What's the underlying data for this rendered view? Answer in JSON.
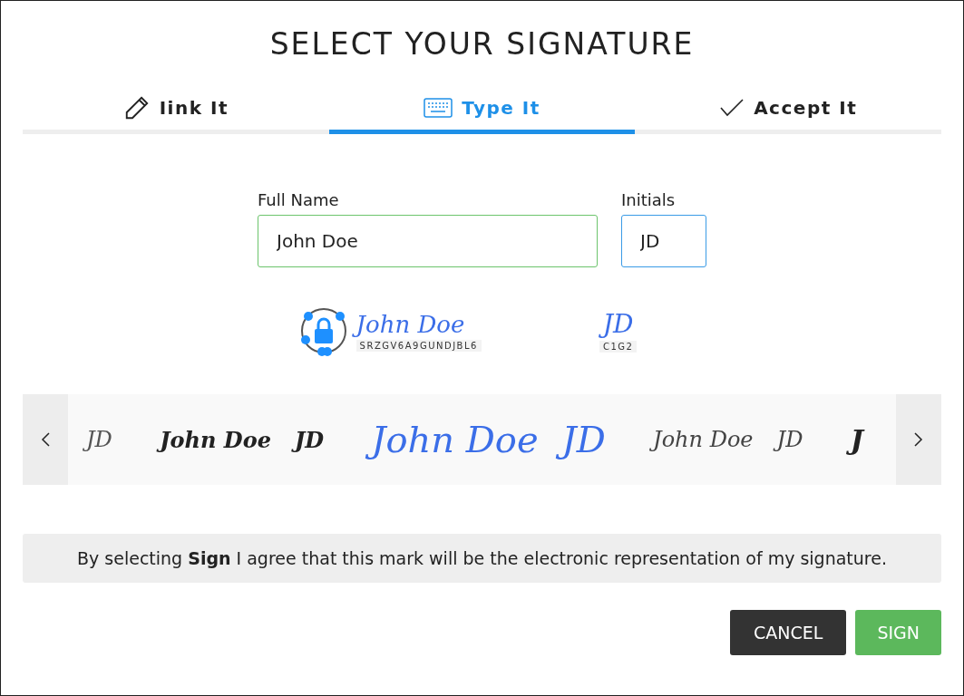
{
  "title": "SELECT YOUR SIGNATURE",
  "tabs": [
    {
      "label": "Iink It",
      "selected": false
    },
    {
      "label": "Type It",
      "selected": true
    },
    {
      "label": "Accept It",
      "selected": false
    }
  ],
  "fields": [
    {
      "label": "Full Name",
      "value": "John Doe",
      "valid": true
    },
    {
      "label": "Initials",
      "value": "JD",
      "valid": false
    }
  ],
  "preview": {
    "signature": "John Doe",
    "signature_code": "SRZGV6A9GUNDJBL6",
    "initials": "JD",
    "initials_code": "C1G2"
  },
  "styles": [
    {
      "initials": "JD",
      "kind": "light",
      "selected": false
    },
    {
      "name": "John Doe",
      "initials": "JD",
      "kind": "bold",
      "selected": false
    },
    {
      "name": "John Doe",
      "initials": "JD",
      "kind": "flow",
      "selected": true
    },
    {
      "name": "John Doe",
      "initials": "JD",
      "kind": "thin",
      "selected": false
    },
    {
      "name": "J",
      "kind": "block",
      "selected": false
    }
  ],
  "notice": "By selecting **Sign** I agree that this mark will be the electronic representation of my signature.",
  "buttons": [
    {
      "label": "CANCEL",
      "kind": "secondary"
    },
    {
      "label": "SIGN",
      "kind": "primary"
    }
  ]
}
